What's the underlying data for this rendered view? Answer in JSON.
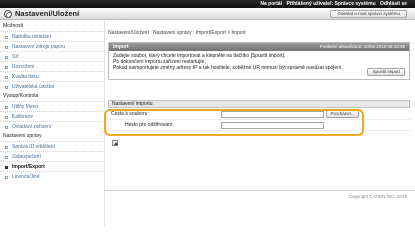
{
  "topbar": {
    "portal": "Na portál",
    "user": "Přihlášený uživatel: Správce systému",
    "logout": "Odhlásit se"
  },
  "header": {
    "title": "Nastavení/Uložení",
    "mail_button": "Odeslat e-mail správci systému"
  },
  "sidebar": {
    "groups": [
      {
        "heading": "Možnosti",
        "items": [
          "Nabídka ovládání",
          "Nastavení zdroje papíru",
          "Síť",
          "Rozvržení",
          "Kvalita tisku",
          "Uživatelská údržba"
        ]
      },
      {
        "heading": "Výstup/Kontrola",
        "items": [
          "Utility Menu",
          "Kalibrace",
          "Ovládání zařízení"
        ]
      },
      {
        "heading": "Nastavení správy",
        "items": [
          "Správa ID oddělení",
          "Zabezpečení",
          "Import/Export",
          "Licence/Jiné"
        ]
      }
    ],
    "active_item": "Import/Export"
  },
  "breadcrumb": "Nastavení/Uložení : Nastavení správy : Import/Export > Import",
  "import_panel": {
    "title": "Import",
    "last_update": "Poslední aktualizace: 20/06 2019 08:18:36",
    "lines": [
      "Zadejte soubor, který chcete importovat a klepněte na tlačítko [Spustit import].",
      "Po dokončení importu zařízení restartujte.",
      "Pokud naimportujete změny adresy IP a tak hostitele, soběžné UR nemusí být správně navázat spojení."
    ],
    "start_button": "Spustit import"
  },
  "import_settings": {
    "heading": "Nastavení importu",
    "file_path_label": "Cesta k souboru:",
    "file_path_value": "",
    "browse_button": "Procházet...",
    "password_label": "Heslo pro odšifrování:",
    "password_value": ""
  },
  "footer": {
    "copyright": "Copyright CANON INC. 2019"
  },
  "colors": {
    "highlight": "#f1a81c",
    "link": "#4a6d94",
    "panel_header": "#808080"
  }
}
